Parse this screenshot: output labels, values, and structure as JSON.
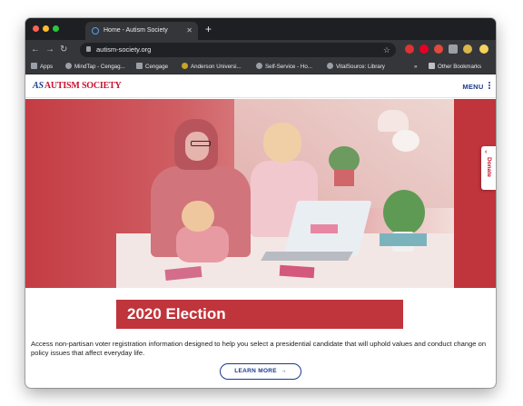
{
  "browser": {
    "tab_title": "Home - Autism Society",
    "new_tab_label": "+",
    "url": "autism-society.org",
    "bookmarks": [
      {
        "label": "Apps",
        "icon": "apps-grid-icon"
      },
      {
        "label": "MindTap - Cengag...",
        "icon": "globe-icon"
      },
      {
        "label": "Cengage",
        "icon": "cengage-icon"
      },
      {
        "label": "Anderson Universi...",
        "icon": "anderson-icon"
      },
      {
        "label": "Self-Service - Ho...",
        "icon": "globe-icon"
      },
      {
        "label": "VitalSource: Library",
        "icon": "globe-icon"
      }
    ],
    "overflow_label": "»",
    "other_bookmarks": "Other Bookmarks"
  },
  "site": {
    "logo_mark": "AS",
    "logo_text": "AUTISM SOCIETY",
    "menu_label": "MENU",
    "donate_label": "Donate"
  },
  "main": {
    "banner_title": "2020 Election",
    "description": "Access non-partisan voter registration information designed to help you select a presidential candidate that will uphold values and conduct change on policy issues that affect everyday life.",
    "cta_label": "LEARN MORE",
    "cta_arrow": "→"
  },
  "colors": {
    "brand_red": "#c0343b",
    "brand_blue": "#1a3a8a",
    "browser_chrome": "#35363a"
  }
}
